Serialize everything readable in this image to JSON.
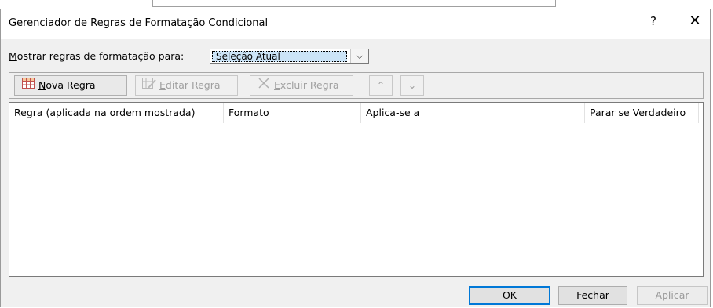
{
  "dialog": {
    "title": "Gerenciador de Regras de Formatação Condicional",
    "help": "?",
    "close": "✕"
  },
  "show_rules": {
    "label_prefix_underlined": "M",
    "label_rest": "ostrar regras de formatação para:",
    "selected": "Seleção Atual",
    "arrow": "⌵"
  },
  "toolbar": {
    "new_rule": {
      "underlined": "N",
      "rest": "ova Regra",
      "icon": "grid-icon"
    },
    "edit_rule": {
      "underlined": "E",
      "rest": "ditar Regra",
      "icon": "edit-grid-icon"
    },
    "delete_rule": {
      "underlined": "E",
      "rest": "xcluir Regra",
      "icon": "x-icon"
    },
    "move_up": "⌃",
    "move_down": "⌄"
  },
  "table": {
    "columns": [
      "Regra (aplicada na ordem mostrada)",
      "Formato",
      "Aplica-se a",
      "Parar se Verdadeiro"
    ],
    "rows": []
  },
  "buttons": {
    "ok": "OK",
    "close": "Fechar",
    "apply": "Aplicar"
  },
  "colors": {
    "selection": "#cce4f7",
    "accent": "#0078d7"
  }
}
